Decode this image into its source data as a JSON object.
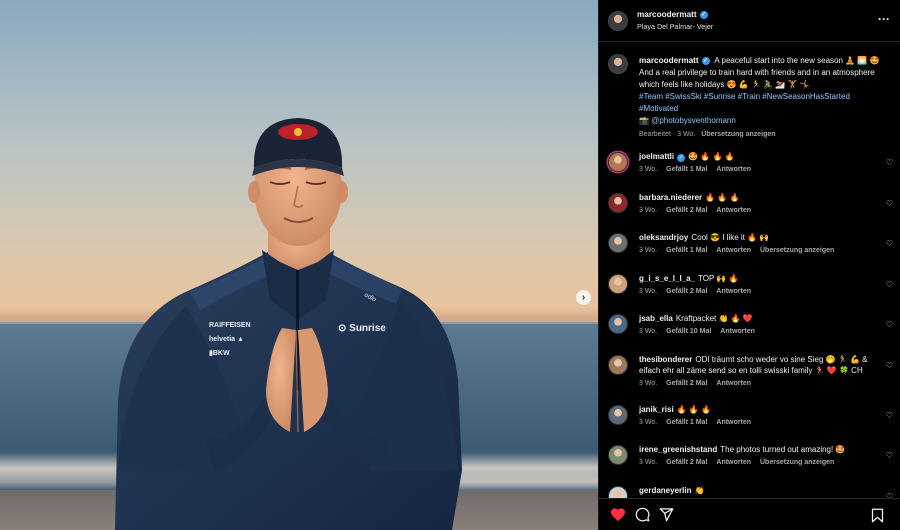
{
  "post": {
    "username": "marcoodermatt",
    "location": "Playa Del Palmar- Vejer",
    "jersey_sponsors": [
      "RAIFFEISEN",
      "helvetia",
      "BKW"
    ],
    "jersey_brand": "Sunrise",
    "jersey_sleeve": "odlo",
    "cap_text": "Red Bull"
  },
  "caption": {
    "username": "marcoodermatt",
    "text": "A peaceful start into the new season 🧘 🌅 🤩 And a real privilege to train hard with friends and in an atmosphere which feels like holidays 😍 💪 🏃 🚴 ⛷️ 🏋️ 🤸",
    "hashtags": "#Team #SwissSki #Sunrise #Train #NewSeasonHasStarted #Motivated",
    "credit_icon": "📸",
    "credit": "@photobysventhomann",
    "edited": "Bearbeitet · 3 Wo.",
    "translate": "Übersetzung anzeigen"
  },
  "comments": [
    {
      "user": "joelmattli",
      "verified": true,
      "text": "🤩 🔥 🔥 🔥",
      "time": "3 Wo.",
      "likes": "Gefällt 1 Mal",
      "reply": "Antworten",
      "translate": "",
      "avatar_color": "#b07850"
    },
    {
      "user": "barbara.niederer",
      "verified": false,
      "text": "🔥 🔥 🔥",
      "time": "3 Wo.",
      "likes": "Gefällt 2 Mal",
      "reply": "Antworten",
      "translate": "",
      "avatar_color": "#8b2a2a"
    },
    {
      "user": "oleksandrjoy",
      "verified": false,
      "text": "Cool 😎 I like it 🔥 🙌",
      "time": "3 Wo.",
      "likes": "Gefällt 1 Mal",
      "reply": "Antworten",
      "translate": "Übersetzung anzeigen",
      "avatar_color": "#6b6f70"
    },
    {
      "user": "g_i_s_e_l_l_a_",
      "verified": false,
      "text": "TOP 🙌 🔥",
      "time": "3 Wo.",
      "likes": "Gefällt 2 Mal",
      "reply": "Antworten",
      "translate": "",
      "avatar_color": "#c9a27a"
    },
    {
      "user": "jsab_ella",
      "verified": false,
      "text": "Kraftpacket 👏 🔥 ❤️",
      "time": "3 Wo.",
      "likes": "Gefällt 10 Mal",
      "reply": "Antworten",
      "translate": "",
      "avatar_color": "#4a6a8a"
    },
    {
      "user": "thesibonderer",
      "verified": false,
      "text": "ODI träumt scho weder vo sine Sieg 🤭 🏃 💪 &",
      "text2": "eifach ehr all zäme send so en tolli swisski family 🏃 ❤️ 🍀 CH",
      "time": "3 Wo.",
      "likes": "Gefällt 2 Mal",
      "reply": "Antworten",
      "translate": "",
      "avatar_color": "#9a7a5a"
    },
    {
      "user": "janik_risi",
      "verified": false,
      "text": "🔥 🔥 🔥",
      "time": "3 Wo.",
      "likes": "Gefällt 1 Mal",
      "reply": "Antworten",
      "translate": "",
      "avatar_color": "#5a6a7a"
    },
    {
      "user": "irene_greenishstand",
      "verified": false,
      "text": "The photos turned out amazing! 🤩",
      "time": "3 Wo.",
      "likes": "Gefällt 2 Mal",
      "reply": "Antworten",
      "translate": "Übersetzung anzeigen",
      "avatar_color": "#7a8a6a"
    },
    {
      "user": "gerdaneyerlin",
      "verified": false,
      "text": "👏",
      "time": "3 Wo.",
      "likes": "Gefällt 1 Mal",
      "reply": "Antworten",
      "translate": "",
      "avatar_color": "#d0d0d0"
    }
  ],
  "colors": {
    "like_red": "#ff3040",
    "verified_blue": "#3797f0",
    "link_blue": "#8cc7ff"
  },
  "icons": {
    "more": "more-options-icon",
    "like": "heart-filled-icon",
    "comment": "comment-icon",
    "share": "share-icon",
    "save": "bookmark-icon",
    "next": "chevron-right-icon"
  }
}
